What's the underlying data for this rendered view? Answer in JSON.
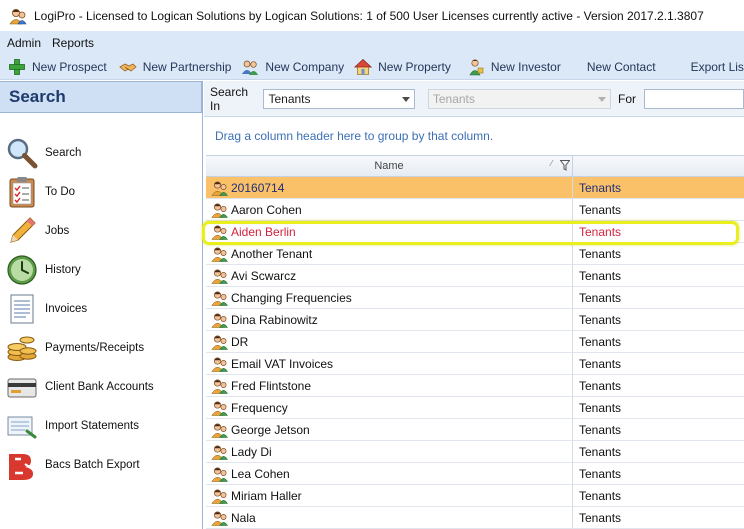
{
  "window": {
    "title": "LogiPro - Licensed to Logican Solutions by Logican Solutions: 1 of 500 User Licenses currently active - Version 2017.2.1.3807"
  },
  "menu": {
    "items": [
      {
        "label": "Admin"
      },
      {
        "label": "Reports"
      }
    ]
  },
  "toolbar": {
    "buttons": [
      {
        "label": "New Prospect",
        "icon": "plus-icon"
      },
      {
        "label": "New Partnership",
        "icon": "handshake-icon"
      },
      {
        "label": "New Company",
        "icon": "people-icon"
      },
      {
        "label": "New Property",
        "icon": "house-icon"
      },
      {
        "label": "New Investor",
        "icon": "investor-icon"
      },
      {
        "label": "New Contact",
        "icon": ""
      },
      {
        "label": "Export Lis",
        "icon": ""
      }
    ]
  },
  "sidebar": {
    "title": "Search",
    "items": [
      {
        "label": "Search",
        "icon": "magnifier-icon"
      },
      {
        "label": "To Do",
        "icon": "clipboard-icon"
      },
      {
        "label": "Jobs",
        "icon": "pencil-icon"
      },
      {
        "label": "History",
        "icon": "clock-icon"
      },
      {
        "label": "Invoices",
        "icon": "invoice-icon"
      },
      {
        "label": "Payments/Receipts",
        "icon": "coins-icon"
      },
      {
        "label": "Client Bank Accounts",
        "icon": "credit-card-icon"
      },
      {
        "label": "Import Statements",
        "icon": "statement-icon"
      },
      {
        "label": "Bacs Batch Export",
        "icon": "bacs-icon"
      }
    ]
  },
  "search": {
    "search_in_label": "Search In",
    "search_in_value": "Tenants",
    "secondary_value": "Tenants",
    "for_label": "For",
    "for_value": ""
  },
  "grid": {
    "group_hint": "Drag a column header here to group by that column.",
    "columns": [
      "Name"
    ],
    "rows": [
      {
        "name": "20160714",
        "type": "Tenants",
        "state": "selected"
      },
      {
        "name": "Aaron Cohen",
        "type": "Tenants",
        "state": ""
      },
      {
        "name": "Aiden Berlin",
        "type": "Tenants",
        "state": "highlight"
      },
      {
        "name": "Another Tenant",
        "type": "Tenants",
        "state": ""
      },
      {
        "name": "Avi Scwarcz",
        "type": "Tenants",
        "state": ""
      },
      {
        "name": "Changing Frequencies",
        "type": "Tenants",
        "state": ""
      },
      {
        "name": "Dina Rabinowitz",
        "type": "Tenants",
        "state": ""
      },
      {
        "name": "DR",
        "type": "Tenants",
        "state": ""
      },
      {
        "name": "Email VAT Invoices",
        "type": "Tenants",
        "state": ""
      },
      {
        "name": "Fred Flintstone",
        "type": "Tenants",
        "state": ""
      },
      {
        "name": "Frequency",
        "type": "Tenants",
        "state": ""
      },
      {
        "name": "George Jetson",
        "type": "Tenants",
        "state": ""
      },
      {
        "name": "Lady Di",
        "type": "Tenants",
        "state": ""
      },
      {
        "name": "Lea Cohen",
        "type": "Tenants",
        "state": ""
      },
      {
        "name": "Miriam Haller",
        "type": "Tenants",
        "state": ""
      },
      {
        "name": "Nala",
        "type": "Tenants",
        "state": ""
      }
    ]
  },
  "colors": {
    "selected_row": "#fbc168",
    "highlight_text": "#d2233f",
    "annotation_ring": "#e9ef1c",
    "menu_bg": "#dbe8f7"
  }
}
